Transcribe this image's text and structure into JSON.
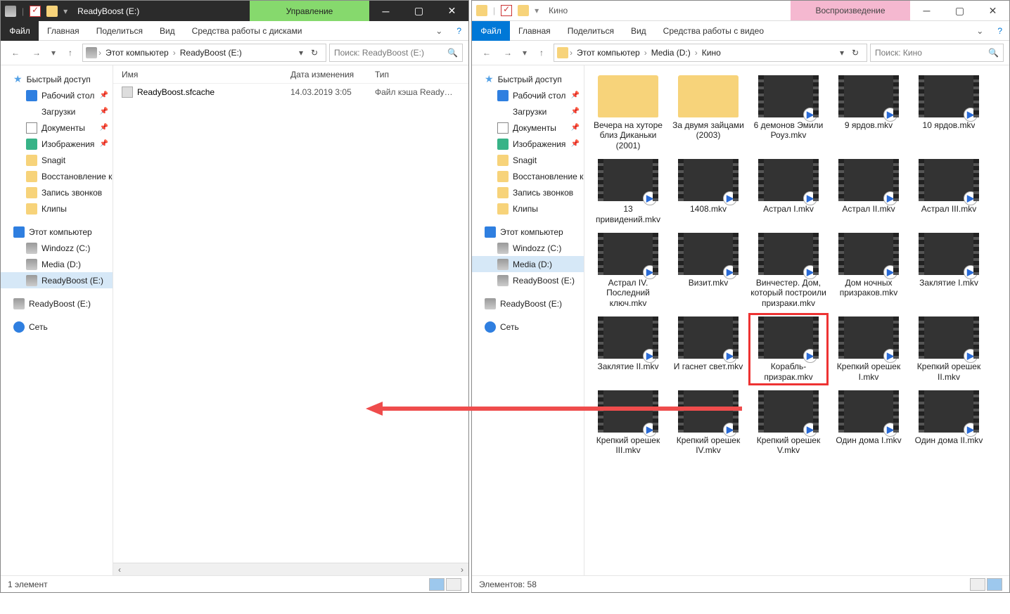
{
  "left": {
    "title": "ReadyBoost (E:)",
    "ctx_tab": "Управление",
    "ribbon": {
      "file": "Файл",
      "tabs": [
        "Главная",
        "Поделиться",
        "Вид"
      ],
      "ctx": "Средства работы с дисками"
    },
    "crumbs": [
      "Этот компьютер",
      "ReadyBoost (E:)"
    ],
    "search_placeholder": "Поиск: ReadyBoost (E:)",
    "columns": {
      "name": "Имя",
      "date": "Дата изменения",
      "type": "Тип"
    },
    "rows": [
      {
        "name": "ReadyBoost.sfcache",
        "date": "14.03.2019 3:05",
        "type": "Файл кэша Ready…"
      }
    ],
    "status": "1 элемент"
  },
  "right": {
    "title": "Кино",
    "ctx_tab": "Воспроизведение",
    "ribbon": {
      "file": "Файл",
      "tabs": [
        "Главная",
        "Поделиться",
        "Вид"
      ],
      "ctx": "Средства работы с видео"
    },
    "crumbs": [
      "Этот компьютер",
      "Media (D:)",
      "Кино"
    ],
    "search_placeholder": "Поиск: Кино",
    "items": [
      {
        "name": "Вечера на хуторе близ Диканьки (2001)",
        "kind": "folder"
      },
      {
        "name": "За двумя зайцами (2003)",
        "kind": "folder"
      },
      {
        "name": "6 демонов Эмили Роуз.mkv",
        "kind": "video"
      },
      {
        "name": "9 ярдов.mkv",
        "kind": "video"
      },
      {
        "name": "10 ярдов.mkv",
        "kind": "video"
      },
      {
        "name": "13 привидений.mkv",
        "kind": "video"
      },
      {
        "name": "1408.mkv",
        "kind": "video"
      },
      {
        "name": "Астрал I.mkv",
        "kind": "video"
      },
      {
        "name": "Астрал II.mkv",
        "kind": "video"
      },
      {
        "name": "Астрал III.mkv",
        "kind": "video"
      },
      {
        "name": "Астрал IV. Последний ключ.mkv",
        "kind": "video"
      },
      {
        "name": "Визит.mkv",
        "kind": "video"
      },
      {
        "name": "Винчестер. Дом, который построили призраки.mkv",
        "kind": "video"
      },
      {
        "name": "Дом ночных призраков.mkv",
        "kind": "video"
      },
      {
        "name": "Заклятие I.mkv",
        "kind": "video"
      },
      {
        "name": "Заклятие II.mkv",
        "kind": "video"
      },
      {
        "name": "И гаснет свет.mkv",
        "kind": "video"
      },
      {
        "name": "Корабль-призрак.mkv",
        "kind": "video",
        "selected": true
      },
      {
        "name": "Крепкий орешек I.mkv",
        "kind": "video"
      },
      {
        "name": "Крепкий орешек II.mkv",
        "kind": "video"
      },
      {
        "name": "Крепкий орешек III.mkv",
        "kind": "video"
      },
      {
        "name": "Крепкий орешек IV.mkv",
        "kind": "video"
      },
      {
        "name": "Крепкий орешек V.mkv",
        "kind": "video"
      },
      {
        "name": "Один дома I.mkv",
        "kind": "video"
      },
      {
        "name": "Один дома II.mkv",
        "kind": "video"
      }
    ],
    "status": "Элементов: 58"
  },
  "sidebar": {
    "quick": "Быстрый доступ",
    "items": [
      {
        "label": "Рабочий стол",
        "icon": "ico-desk",
        "pin": true
      },
      {
        "label": "Загрузки",
        "icon": "ico-dl",
        "pin": true
      },
      {
        "label": "Документы",
        "icon": "ico-doc",
        "pin": true
      },
      {
        "label": "Изображения",
        "icon": "ico-img",
        "pin": true
      },
      {
        "label": "Snagit",
        "icon": "ico-folder"
      },
      {
        "label": "Восстановление ко",
        "icon": "ico-folder"
      },
      {
        "label": "Запись звонков",
        "icon": "ico-folder"
      },
      {
        "label": "Клипы",
        "icon": "ico-folder"
      }
    ],
    "pc": "Этот компьютер",
    "drives_left": [
      {
        "label": "Windozz (C:)"
      },
      {
        "label": "Media (D:)"
      },
      {
        "label": "ReadyBoost (E:)",
        "sel": true
      }
    ],
    "below_left": [
      {
        "label": "ReadyBoost (E:)"
      }
    ],
    "drives_right": [
      {
        "label": "Windozz (C:)"
      },
      {
        "label": "Media (D:)",
        "sel": true
      },
      {
        "label": "ReadyBoost (E:)"
      }
    ],
    "below_right": [
      {
        "label": "ReadyBoost (E:)"
      }
    ],
    "net": "Сеть"
  }
}
